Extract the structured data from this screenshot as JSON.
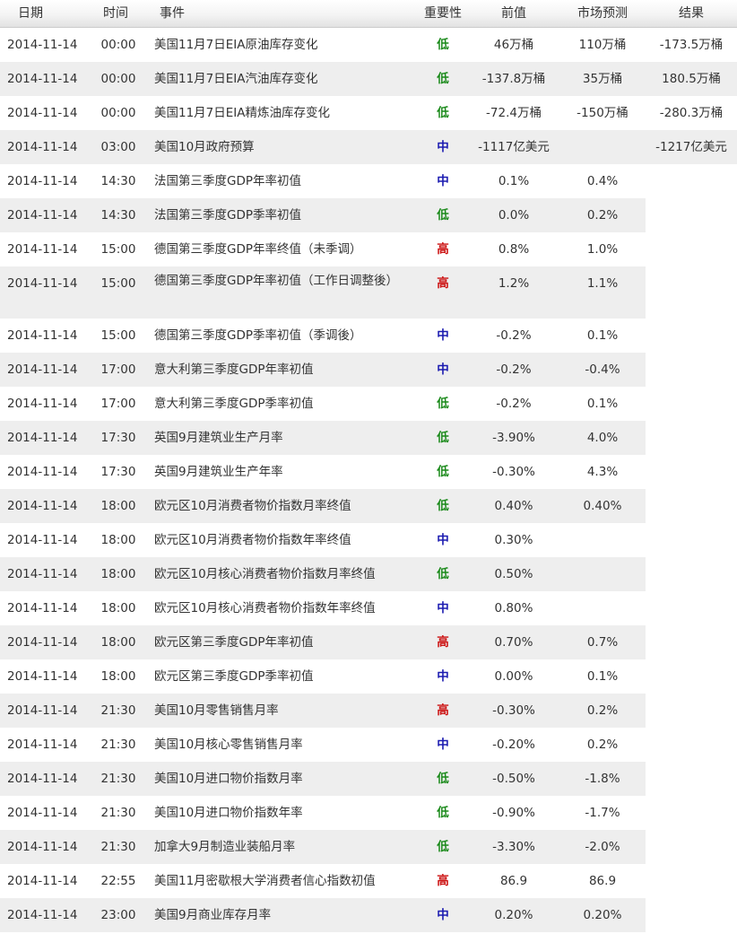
{
  "header": {
    "date": "日期",
    "time": "时间",
    "event": "事件",
    "importance": "重要性",
    "previous": "前值",
    "forecast": "市场预测",
    "result": "结果"
  },
  "colors": {
    "low": "#1b8a1b",
    "medium": "#1a1ab0",
    "high": "#cc1111",
    "row_alt": "#eeeeee"
  },
  "rows": [
    {
      "date": "2014-11-14",
      "time": "00:00",
      "event": "美国11月7日EIA原油库存变化",
      "importance": "低",
      "previous": "46万桶",
      "forecast": "110万桶",
      "result": "-173.5万桶"
    },
    {
      "date": "2014-11-14",
      "time": "00:00",
      "event": "美国11月7日EIA汽油库存变化",
      "importance": "低",
      "previous": "-137.8万桶",
      "forecast": "35万桶",
      "result": "180.5万桶"
    },
    {
      "date": "2014-11-14",
      "time": "00:00",
      "event": "美国11月7日EIA精炼油库存变化",
      "importance": "低",
      "previous": "-72.4万桶",
      "forecast": "-150万桶",
      "result": "-280.3万桶"
    },
    {
      "date": "2014-11-14",
      "time": "03:00",
      "event": "美国10月政府预算",
      "importance": "中",
      "previous": "-1117亿美元",
      "forecast": "",
      "result": "-1217亿美元"
    },
    {
      "date": "2014-11-14",
      "time": "14:30",
      "event": "法国第三季度GDP年率初值",
      "importance": "中",
      "previous": "0.1%",
      "forecast": "0.4%",
      "result": ""
    },
    {
      "date": "2014-11-14",
      "time": "14:30",
      "event": "法国第三季度GDP季率初值",
      "importance": "低",
      "previous": "0.0%",
      "forecast": "0.2%",
      "result": ""
    },
    {
      "date": "2014-11-14",
      "time": "15:00",
      "event": "德国第三季度GDP年率终值（未季调）",
      "importance": "高",
      "previous": "0.8%",
      "forecast": "1.0%",
      "result": ""
    },
    {
      "date": "2014-11-14",
      "time": "15:00",
      "event": "德国第三季度GDP年率初值（工作日调整後）",
      "importance": "高",
      "previous": "1.2%",
      "forecast": "1.1%",
      "result": ""
    },
    {
      "date": "2014-11-14",
      "time": "15:00",
      "event": "德国第三季度GDP季率初值（季调後）",
      "importance": "中",
      "previous": "-0.2%",
      "forecast": "0.1%",
      "result": ""
    },
    {
      "date": "2014-11-14",
      "time": "17:00",
      "event": "意大利第三季度GDP年率初值",
      "importance": "中",
      "previous": "-0.2%",
      "forecast": "-0.4%",
      "result": ""
    },
    {
      "date": "2014-11-14",
      "time": "17:00",
      "event": "意大利第三季度GDP季率初值",
      "importance": "低",
      "previous": "-0.2%",
      "forecast": "0.1%",
      "result": ""
    },
    {
      "date": "2014-11-14",
      "time": "17:30",
      "event": "英国9月建筑业生产月率",
      "importance": "低",
      "previous": "-3.90%",
      "forecast": "4.0%",
      "result": ""
    },
    {
      "date": "2014-11-14",
      "time": "17:30",
      "event": "英国9月建筑业生产年率",
      "importance": "低",
      "previous": "-0.30%",
      "forecast": "4.3%",
      "result": ""
    },
    {
      "date": "2014-11-14",
      "time": "18:00",
      "event": "欧元区10月消费者物价指数月率终值",
      "importance": "低",
      "previous": "0.40%",
      "forecast": "0.40%",
      "result": ""
    },
    {
      "date": "2014-11-14",
      "time": "18:00",
      "event": "欧元区10月消费者物价指数年率终值",
      "importance": "中",
      "previous": "0.30%",
      "forecast": "",
      "result": ""
    },
    {
      "date": "2014-11-14",
      "time": "18:00",
      "event": "欧元区10月核心消费者物价指数月率终值",
      "importance": "低",
      "previous": "0.50%",
      "forecast": "",
      "result": ""
    },
    {
      "date": "2014-11-14",
      "time": "18:00",
      "event": "欧元区10月核心消费者物价指数年率终值",
      "importance": "中",
      "previous": "0.80%",
      "forecast": "",
      "result": ""
    },
    {
      "date": "2014-11-14",
      "time": "18:00",
      "event": "欧元区第三季度GDP年率初值",
      "importance": "高",
      "previous": "0.70%",
      "forecast": "0.7%",
      "result": ""
    },
    {
      "date": "2014-11-14",
      "time": "18:00",
      "event": "欧元区第三季度GDP季率初值",
      "importance": "中",
      "previous": "0.00%",
      "forecast": "0.1%",
      "result": ""
    },
    {
      "date": "2014-11-14",
      "time": "21:30",
      "event": "美国10月零售销售月率",
      "importance": "高",
      "previous": "-0.30%",
      "forecast": "0.2%",
      "result": ""
    },
    {
      "date": "2014-11-14",
      "time": "21:30",
      "event": "美国10月核心零售销售月率",
      "importance": "中",
      "previous": "-0.20%",
      "forecast": "0.2%",
      "result": ""
    },
    {
      "date": "2014-11-14",
      "time": "21:30",
      "event": "美国10月进口物价指数月率",
      "importance": "低",
      "previous": "-0.50%",
      "forecast": "-1.8%",
      "result": ""
    },
    {
      "date": "2014-11-14",
      "time": "21:30",
      "event": "美国10月进口物价指数年率",
      "importance": "低",
      "previous": "-0.90%",
      "forecast": "-1.7%",
      "result": ""
    },
    {
      "date": "2014-11-14",
      "time": "21:30",
      "event": "加拿大9月制造业装船月率",
      "importance": "低",
      "previous": "-3.30%",
      "forecast": "-2.0%",
      "result": ""
    },
    {
      "date": "2014-11-14",
      "time": "22:55",
      "event": "美国11月密歇根大学消费者信心指数初值",
      "importance": "高",
      "previous": "86.9",
      "forecast": "86.9",
      "result": ""
    },
    {
      "date": "2014-11-14",
      "time": "23:00",
      "event": "美国9月商业库存月率",
      "importance": "中",
      "previous": "0.20%",
      "forecast": "0.20%",
      "result": ""
    }
  ]
}
